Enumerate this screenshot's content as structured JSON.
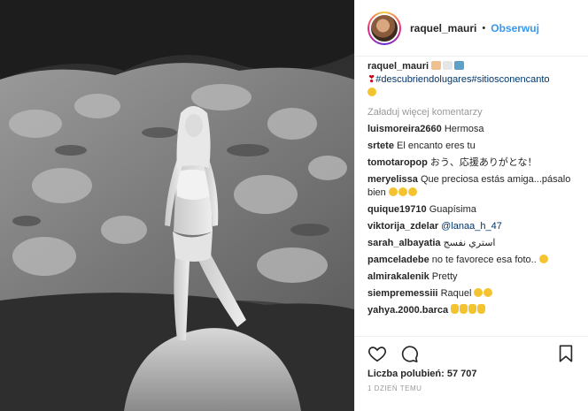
{
  "post": {
    "username": "raquel_mauri",
    "separator": "•",
    "follow_label": "Obserwuj"
  },
  "caption": {
    "username": "raquel_mauri",
    "hashtags": "#descubriendolugares#sitiosconencanto"
  },
  "load_more_label": "Załaduj więcej komentarzy",
  "comments": [
    {
      "user": "luismoreira2660",
      "text": "Hermosa"
    },
    {
      "user": "srtete",
      "text": "El encanto eres tu"
    },
    {
      "user": "tomotaropop",
      "text": "おう、応援ありがとな！"
    },
    {
      "user": "meryelissa",
      "text": "Que preciosa estás amiga...pásalo bien"
    },
    {
      "user": "quique19710",
      "text": "Guapísima"
    },
    {
      "user": "viktorija_zdelar",
      "text": "@lanaa_h_47"
    },
    {
      "user": "sarah_albayatia",
      "text": "استري نفسج"
    },
    {
      "user": "pamceladebe",
      "text": "no te favorece esa foto.."
    },
    {
      "user": "almirakalenik",
      "text": "Pretty"
    },
    {
      "user": "siempremessiii",
      "text": "Raquel"
    },
    {
      "user": "yahya.2000.barca",
      "text": ""
    }
  ],
  "likes_label": "Liczba polubień: 57 707",
  "time_label": "1 DZIEŃ TEMU",
  "icons": [
    "heart-icon",
    "comment-icon",
    "bookmark-icon"
  ],
  "colors": {
    "accent": "#3897f0",
    "text": "#262626",
    "muted": "#999999",
    "mention": "#003569"
  }
}
